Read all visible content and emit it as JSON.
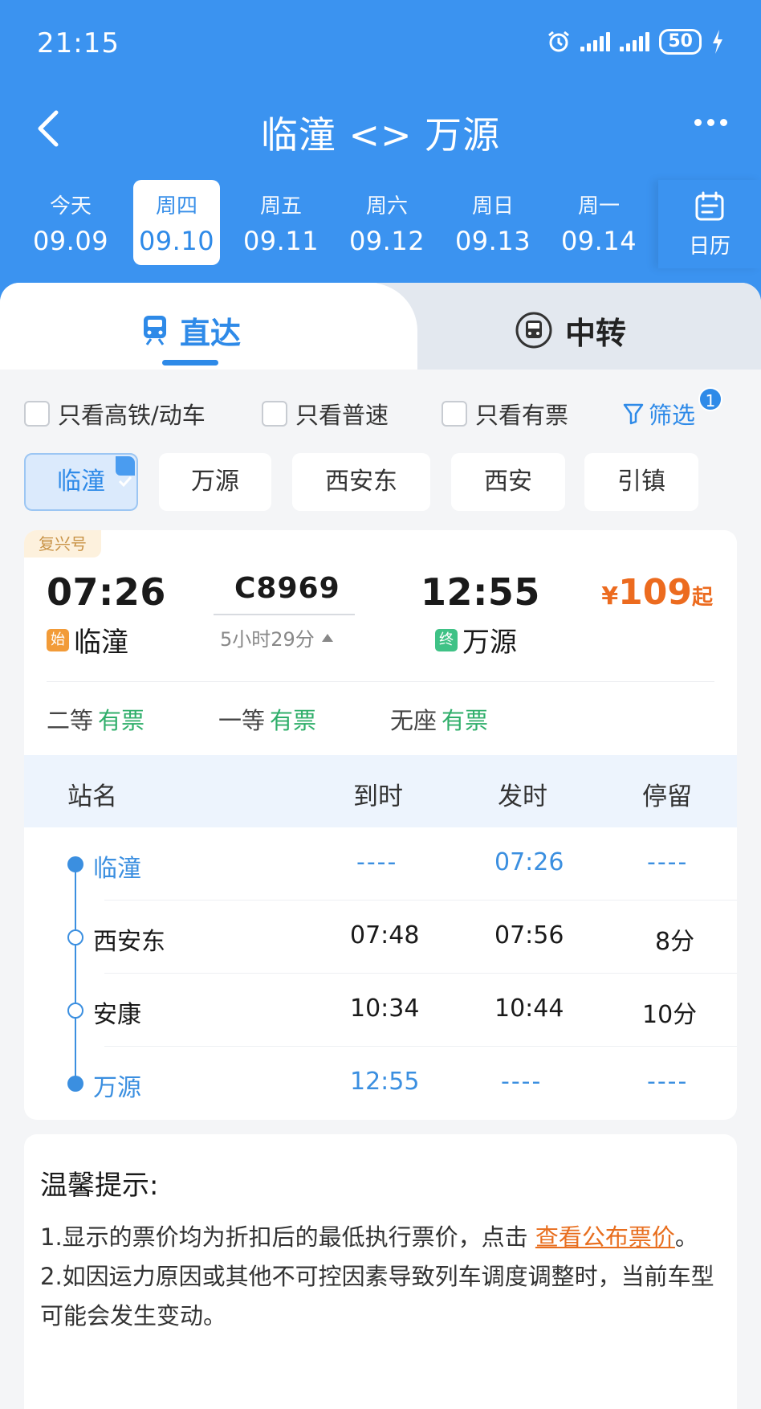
{
  "status": {
    "time": "21:15",
    "battery": "50"
  },
  "header": {
    "title": "临潼 <> 万源"
  },
  "dates": [
    {
      "weekday": "今天",
      "date": "09.09"
    },
    {
      "weekday": "周四",
      "date": "09.10"
    },
    {
      "weekday": "周五",
      "date": "09.11"
    },
    {
      "weekday": "周六",
      "date": "09.12"
    },
    {
      "weekday": "周日",
      "date": "09.13"
    },
    {
      "weekday": "周一",
      "date": "09.14"
    }
  ],
  "calendar_label": "日历",
  "tabs": {
    "direct": "直达",
    "transfer": "中转"
  },
  "filters": {
    "high_speed": "只看高铁/动车",
    "normal": "只看普速",
    "available": "只看有票",
    "filter_label": "筛选",
    "filter_count": "1"
  },
  "stations_chips": [
    "临潼",
    "万源",
    "西安东",
    "西安",
    "引镇"
  ],
  "train": {
    "tag": "复兴号",
    "dep_time": "07:26",
    "arr_time": "12:55",
    "number": "C8969",
    "duration": "5小时29分",
    "dep_station": "临潼",
    "arr_station": "万源",
    "start_mark": "始",
    "end_mark": "终",
    "price_symbol": "¥",
    "price": "109",
    "price_suffix": "起",
    "seats": [
      {
        "type": "二等",
        "status": "有票"
      },
      {
        "type": "一等",
        "status": "有票"
      },
      {
        "type": "无座",
        "status": "有票"
      }
    ]
  },
  "stops_table": {
    "headers": [
      "站名",
      "到时",
      "发时",
      "停留"
    ],
    "rows": [
      {
        "station": "临潼",
        "arrive": "----",
        "depart": "07:26",
        "stay": "----"
      },
      {
        "station": "西安东",
        "arrive": "07:48",
        "depart": "07:56",
        "stay": "8分"
      },
      {
        "station": "安康",
        "arrive": "10:34",
        "depart": "10:44",
        "stay": "10分"
      },
      {
        "station": "万源",
        "arrive": "12:55",
        "depart": "----",
        "stay": "----"
      }
    ]
  },
  "tips": {
    "title": "温馨提示:",
    "line1_before": "1.显示的票价均为折扣后的最低执行票价，点击 ",
    "line1_link": "查看公布票价",
    "line1_after": "。",
    "line2": "2.如因运力原因或其他不可控因素导致列车调度调整时，当前车型可能会发生变动。"
  },
  "colors": {
    "primary": "#3b93f0",
    "accent": "#2e8ae8",
    "price": "#ec6b1f",
    "available": "#2fae6a"
  }
}
